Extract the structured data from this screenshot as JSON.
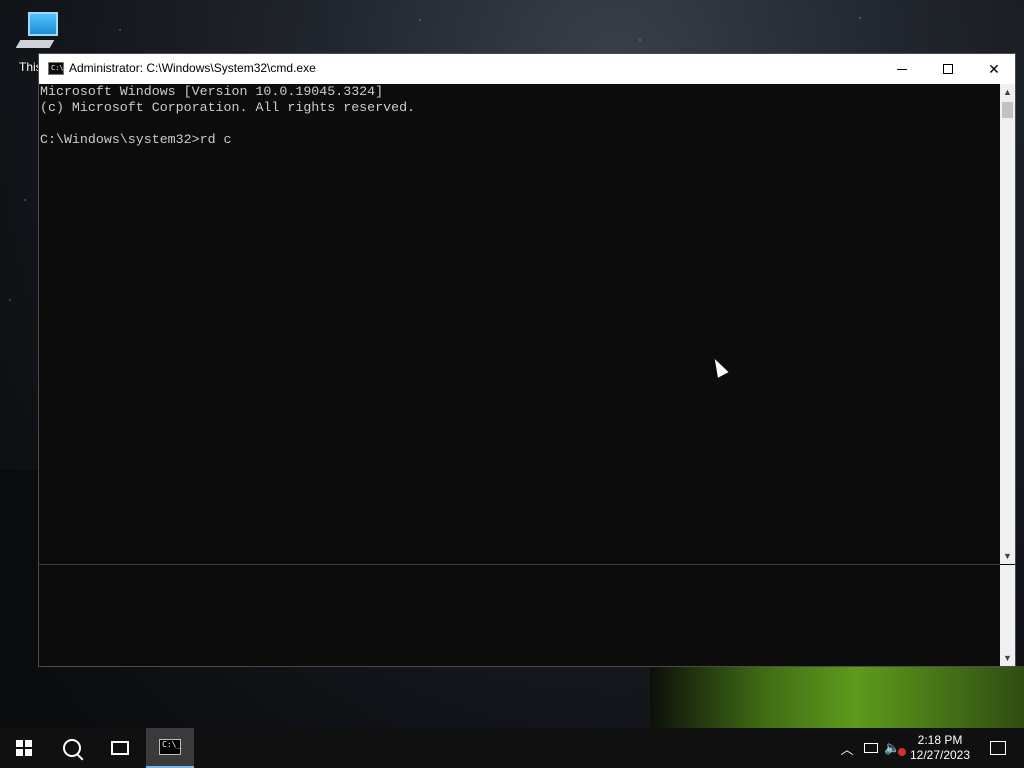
{
  "desktop": {
    "icon_label": "This PC"
  },
  "window": {
    "title": "Administrator: C:\\Windows\\System32\\cmd.exe",
    "minimize_icon": "minimize-icon",
    "maximize_icon": "maximize-icon",
    "close_icon": "close-icon",
    "console": {
      "lines": [
        "Microsoft Windows [Version 10.0.19045.3324]",
        "(c) Microsoft Corporation. All rights reserved.",
        "",
        "C:\\Windows\\system32>rd c"
      ]
    }
  },
  "taskbar": {
    "start_icon": "windows-logo-icon",
    "search_icon": "search-icon",
    "taskview_icon": "task-view-icon",
    "active_app_icon": "cmd-icon",
    "tray": {
      "time": "2:18 PM",
      "date": "12/27/2023"
    }
  },
  "colors": {
    "console_bg": "#0c0c0c",
    "console_text": "#cccccc",
    "titlebar": "#ffffff",
    "taskbar": "#101010"
  }
}
